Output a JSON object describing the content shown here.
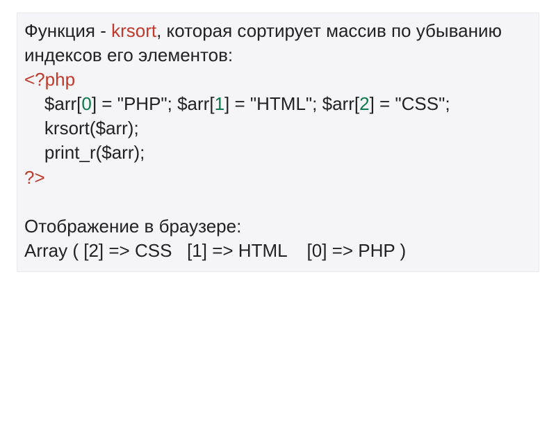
{
  "desc": {
    "prefix": "Функция - ",
    "func": "krsort",
    "suffix": ", которая сортирует массив по убыванию индексов его элементов:"
  },
  "code": {
    "open_tag": "<?php",
    "assign_line": {
      "indent": "    ",
      "arr": "$arr",
      "i0": "0",
      "v0": "\"PHP\"",
      "i1": "1",
      "v1": "\"HTML\"",
      "i2": "2",
      "v2": "\"CSS\""
    },
    "call1": "    krsort($arr);",
    "call2": "    print_r($arr);",
    "close_tag": "?>"
  },
  "output_label": "Отображение в браузере:",
  "output_line": "Array ( [2] => CSS   [1] => HTML    [0] => PHP )"
}
